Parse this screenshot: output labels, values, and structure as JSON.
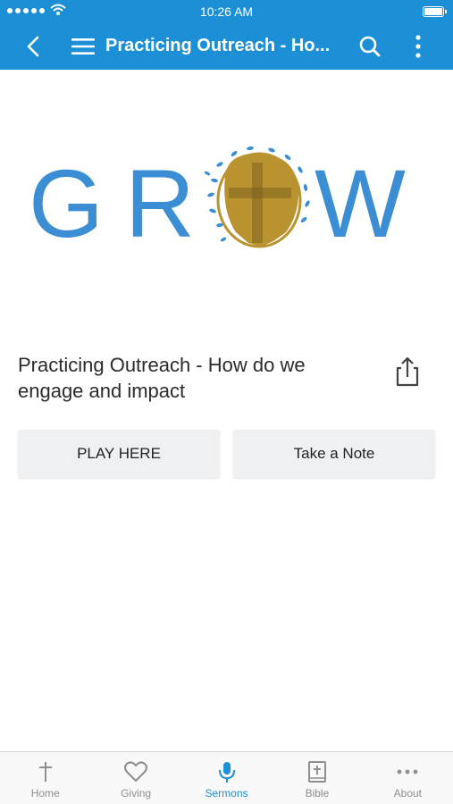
{
  "status_bar": {
    "time": "10:26 AM"
  },
  "nav": {
    "title": "Practicing Outreach - Ho...",
    "back_icon": "chevron-left-icon",
    "menu_icon": "hamburger-icon",
    "search_icon": "search-icon",
    "more_icon": "more-vertical-icon"
  },
  "hero": {
    "logo_text": "GROW",
    "logo_color": "#3b8ed3",
    "cross_color": "#b8932f"
  },
  "sermon": {
    "title": "Practicing Outreach - How do we engage and impact",
    "share_icon": "share-icon"
  },
  "actions": {
    "play_label": "PLAY HERE",
    "note_label": "Take a Note"
  },
  "tabs": [
    {
      "label": "Home",
      "icon": "cross-icon",
      "active": false
    },
    {
      "label": "Giving",
      "icon": "heart-icon",
      "active": false
    },
    {
      "label": "Sermons",
      "icon": "microphone-icon",
      "active": true
    },
    {
      "label": "Bible",
      "icon": "bible-icon",
      "active": false
    },
    {
      "label": "About",
      "icon": "more-horizontal-icon",
      "active": false
    }
  ],
  "colors": {
    "primary": "#1c8fd6",
    "tab_inactive": "#8e8e93",
    "button_bg": "#eef0f2"
  }
}
